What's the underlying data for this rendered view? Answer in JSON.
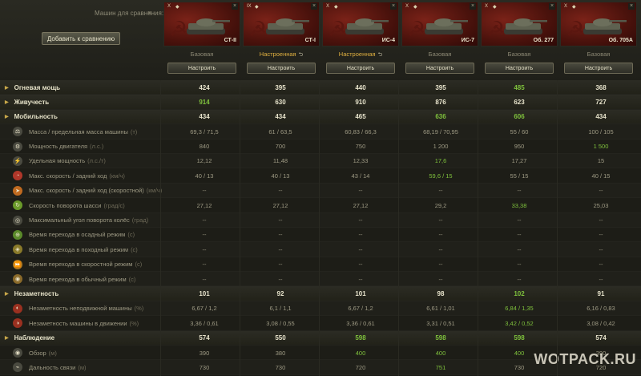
{
  "header": {
    "count_label": "Машин для сравнения:",
    "count_value": "6",
    "clear_icon": "×",
    "add_button": "Добавить к сравнению"
  },
  "vehicles": [
    {
      "tier": "X",
      "name": "СТ-II",
      "config": "Базовая",
      "tuned": false,
      "button": "Настроить"
    },
    {
      "tier": "IX",
      "name": "СТ-I",
      "config": "Настроенная",
      "tuned": true,
      "button": "Настроить"
    },
    {
      "tier": "X",
      "name": "ИС-4",
      "config": "Настроенная",
      "tuned": true,
      "button": "Настроить"
    },
    {
      "tier": "X",
      "name": "ИС-7",
      "config": "Базовая",
      "tuned": false,
      "button": "Настроить"
    },
    {
      "tier": "X",
      "name": "Об. 277",
      "config": "Базовая",
      "tuned": false,
      "button": "Настроить"
    },
    {
      "tier": "X",
      "name": "Об. 705А",
      "config": "Базовая",
      "tuned": false,
      "button": "Настроить"
    }
  ],
  "rows": [
    {
      "kind": "section",
      "label": "Огневая мощь",
      "unit": "",
      "icon": "",
      "values": [
        "424",
        "395",
        "440",
        "395",
        "485",
        "368"
      ],
      "green": [
        false,
        false,
        false,
        false,
        true,
        false
      ]
    },
    {
      "kind": "section",
      "label": "Живучесть",
      "unit": "",
      "icon": "",
      "values": [
        "914",
        "630",
        "910",
        "876",
        "623",
        "727"
      ],
      "green": [
        true,
        false,
        false,
        false,
        false,
        false
      ]
    },
    {
      "kind": "section",
      "label": "Мобильность",
      "unit": "",
      "icon": "",
      "values": [
        "434",
        "434",
        "465",
        "636",
        "606",
        "434"
      ],
      "green": [
        false,
        false,
        false,
        true,
        true,
        false
      ]
    },
    {
      "kind": "sub",
      "label": "Масса / предельная масса машины",
      "unit": "(т)",
      "icon": "weight-icon",
      "values": [
        "69,3 / 71,5",
        "61 / 63,5",
        "60,83 / 66,3",
        "68,19 / 70,95",
        "55 / 60",
        "100 / 105"
      ],
      "green": [
        false,
        false,
        false,
        false,
        false,
        false
      ]
    },
    {
      "kind": "sub",
      "label": "Мощность двигателя",
      "unit": "(л.с.)",
      "icon": "engine-icon",
      "values": [
        "840",
        "700",
        "750",
        "1 200",
        "950",
        "1 500"
      ],
      "green": [
        false,
        false,
        false,
        false,
        false,
        true
      ]
    },
    {
      "kind": "sub",
      "label": "Удельная мощность",
      "unit": "(л.с./т)",
      "icon": "power-ratio-icon",
      "values": [
        "12,12",
        "11,48",
        "12,33",
        "17,6",
        "17,27",
        "15"
      ],
      "green": [
        false,
        false,
        false,
        true,
        false,
        false
      ]
    },
    {
      "kind": "sub",
      "label": "Макс. скорость / задний ход",
      "unit": "(км/ч)",
      "icon": "speed-icon",
      "values": [
        "40 / 13",
        "40 / 13",
        "43 / 14",
        "59,6 / 15",
        "55 / 15",
        "40 / 15"
      ],
      "green": [
        false,
        false,
        false,
        true,
        false,
        false
      ]
    },
    {
      "kind": "sub",
      "label": "Макс. скорость / задний ход (скоростной)",
      "unit": "(км/ч)",
      "icon": "speed-mode-icon",
      "values": [
        "--",
        "--",
        "--",
        "--",
        "--",
        "--"
      ],
      "green": [
        false,
        false,
        false,
        false,
        false,
        false
      ]
    },
    {
      "kind": "sub",
      "label": "Скорость поворота шасси",
      "unit": "(град/с)",
      "icon": "traverse-icon",
      "values": [
        "27,12",
        "27,12",
        "27,12",
        "29,2",
        "33,38",
        "25,03"
      ],
      "green": [
        false,
        false,
        false,
        false,
        true,
        false
      ]
    },
    {
      "kind": "sub",
      "label": "Максимальный угол поворота колёс",
      "unit": "(град)",
      "icon": "wheel-angle-icon",
      "values": [
        "--",
        "--",
        "--",
        "--",
        "--",
        "--"
      ],
      "green": [
        false,
        false,
        false,
        false,
        false,
        false
      ]
    },
    {
      "kind": "sub",
      "label": "Время перехода в осадный режим",
      "unit": "(с)",
      "icon": "siege-mode-icon",
      "values": [
        "--",
        "--",
        "--",
        "--",
        "--",
        "--"
      ],
      "green": [
        false,
        false,
        false,
        false,
        false,
        false
      ]
    },
    {
      "kind": "sub",
      "label": "Время перехода в походный режим",
      "unit": "(с)",
      "icon": "travel-mode-icon",
      "values": [
        "--",
        "--",
        "--",
        "--",
        "--",
        "--"
      ],
      "green": [
        false,
        false,
        false,
        false,
        false,
        false
      ]
    },
    {
      "kind": "sub",
      "label": "Время перехода в скоростной режим",
      "unit": "(с)",
      "icon": "fast-mode-icon",
      "values": [
        "--",
        "--",
        "--",
        "--",
        "--",
        "--"
      ],
      "green": [
        false,
        false,
        false,
        false,
        false,
        false
      ]
    },
    {
      "kind": "sub",
      "label": "Время перехода в обычный режим",
      "unit": "(с)",
      "icon": "normal-mode-icon",
      "values": [
        "--",
        "--",
        "--",
        "--",
        "--",
        "--"
      ],
      "green": [
        false,
        false,
        false,
        false,
        false,
        false
      ]
    },
    {
      "kind": "section",
      "label": "Незаметность",
      "unit": "",
      "icon": "",
      "values": [
        "101",
        "92",
        "101",
        "98",
        "102",
        "91"
      ],
      "green": [
        false,
        false,
        false,
        false,
        true,
        false
      ]
    },
    {
      "kind": "sub",
      "label": "Незаметность неподвижной машины",
      "unit": "(%)",
      "icon": "camo-still-icon",
      "values": [
        "6,67 / 1,2",
        "6,1 / 1,1",
        "6,67 / 1,2",
        "6,61 / 1,01",
        "6,84 / 1,35",
        "6,16 / 0,83"
      ],
      "green": [
        false,
        false,
        false,
        false,
        true,
        false
      ]
    },
    {
      "kind": "sub",
      "label": "Незаметность машины в движении",
      "unit": "(%)",
      "icon": "camo-moving-icon",
      "values": [
        "3,36 / 0,61",
        "3,08 / 0,55",
        "3,36 / 0,61",
        "3,31 / 0,51",
        "3,42 / 0,52",
        "3,08 / 0,42"
      ],
      "green": [
        false,
        false,
        false,
        false,
        true,
        false
      ]
    },
    {
      "kind": "section",
      "label": "Наблюдение",
      "unit": "",
      "icon": "",
      "values": [
        "574",
        "550",
        "598",
        "598",
        "598",
        "574"
      ],
      "green": [
        false,
        false,
        true,
        true,
        true,
        false
      ]
    },
    {
      "kind": "sub",
      "label": "Обзор",
      "unit": "(м)",
      "icon": "view-range-icon",
      "values": [
        "390",
        "380",
        "400",
        "400",
        "400",
        "390"
      ],
      "green": [
        false,
        false,
        true,
        true,
        true,
        false
      ]
    },
    {
      "kind": "sub",
      "label": "Дальность связи",
      "unit": "(м)",
      "icon": "radio-range-icon",
      "values": [
        "730",
        "730",
        "720",
        "751",
        "730",
        "720"
      ],
      "green": [
        false,
        false,
        false,
        true,
        false,
        false
      ]
    }
  ],
  "watermark": "WOTPACK.RU",
  "colors": {
    "green": "#7ec03c",
    "gold": "#e0b040"
  }
}
